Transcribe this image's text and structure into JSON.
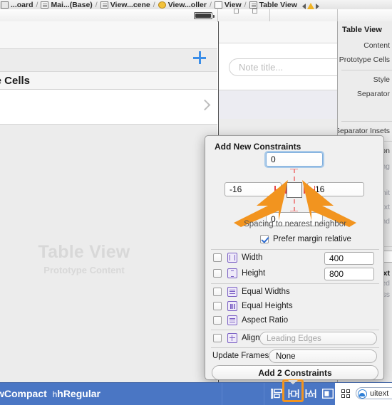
{
  "breadcrumb": {
    "items": [
      {
        "label": "...oard",
        "icon": "folder-icon"
      },
      {
        "label": "Mai...(Base)",
        "icon": "storyboard-icon"
      },
      {
        "label": "View...cene",
        "icon": "scene-icon"
      },
      {
        "label": "View...oller",
        "icon": "view-controller-icon"
      },
      {
        "label": "View",
        "icon": "view-icon"
      },
      {
        "label": "Table View",
        "icon": "table-view-icon"
      }
    ],
    "warning_icon": "warning-triangle-icon",
    "nav_back_icon": "triangle-left-icon",
    "nav_forward_icon": "triangle-right-icon"
  },
  "canvas": {
    "section_header": "...pe Cells",
    "add_icon": "plus-icon",
    "disclosure_icon": "chevron-right-icon",
    "watermark_title": "Table View",
    "watermark_subtitle": "Prototype Content",
    "battery_icon": "battery-icon"
  },
  "mid_canvas": {
    "note_placeholder": "Note title..."
  },
  "inspector": {
    "title": "Table View",
    "rows": [
      {
        "label": "Content"
      },
      {
        "label": "Prototype Cells"
      },
      {
        "label": "Style"
      },
      {
        "label": "Separator"
      },
      {
        "label": "Separator Insets"
      },
      {
        "label": "Selection"
      },
      {
        "label": "...ing"
      },
      {
        "label": "...nit"
      },
      {
        "label": "...ext"
      },
      {
        "label": "...nd"
      },
      {
        "label": "...ext"
      },
      {
        "label": "...ed"
      },
      {
        "label": "...ess"
      }
    ]
  },
  "popover": {
    "title": "Add New Constraints",
    "spacing": {
      "top": "0",
      "left": "-16",
      "right": "-16",
      "bottom": "0",
      "hint": "Spacing to nearest neighbor"
    },
    "prefer_margin": {
      "label": "Prefer margin relative",
      "checked": true
    },
    "constraints": [
      {
        "label": "Width",
        "icon": "width-constraint-icon",
        "checked": false,
        "value": "400"
      },
      {
        "label": "Height",
        "icon": "height-constraint-icon",
        "checked": false,
        "value": "800"
      },
      {
        "label": "Equal Widths",
        "icon": "equal-widths-icon",
        "checked": false
      },
      {
        "label": "Equal Heights",
        "icon": "equal-heights-icon",
        "checked": false
      },
      {
        "label": "Aspect Ratio",
        "icon": "aspect-ratio-icon",
        "checked": false
      }
    ],
    "align": {
      "label": "Align",
      "icon": "align-icon",
      "checked": false,
      "value": "Leading Edges"
    },
    "update_frames": {
      "label": "Update Frames",
      "value": "None"
    },
    "submit_label": "Add 2 Constraints",
    "annotation_color": "#F2941F",
    "constraint_red": "#E84545"
  },
  "statusbar": {
    "size_class": "wCompact",
    "size_class_secondary": "hRegular",
    "icons": [
      {
        "name": "stack-view-icon"
      },
      {
        "name": "align-constraints-icon",
        "highlighted": true
      },
      {
        "name": "pin-constraints-icon"
      },
      {
        "name": "resolve-issues-icon"
      },
      {
        "name": "assistant-grid-icon"
      }
    ],
    "zoom_pill": "uitext",
    "accent_color": "#4A76C4",
    "highlight_color": "#F2941F"
  }
}
